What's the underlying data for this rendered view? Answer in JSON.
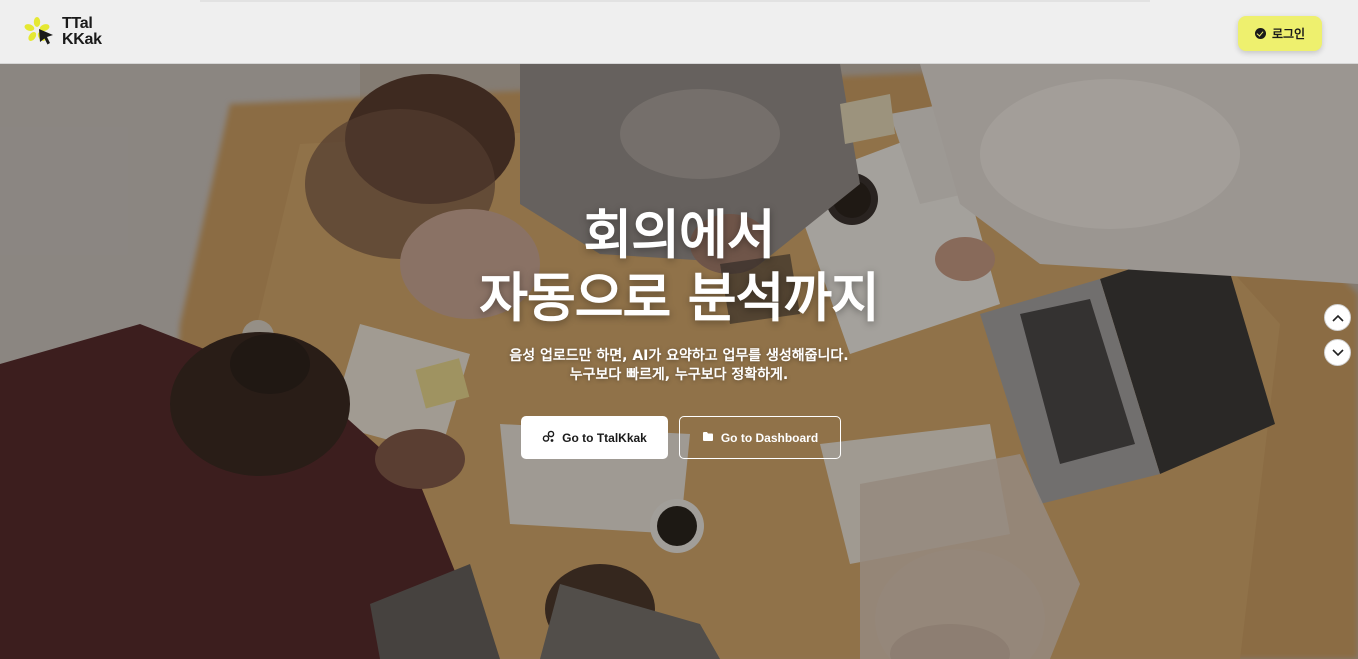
{
  "header": {
    "logo_line1": "TTal",
    "logo_line2": "KKak",
    "login_label": "로그인"
  },
  "hero": {
    "title_line1": "회의에서",
    "title_line2": "자동으로 분석까지",
    "subtitle_line1": "음성 업로드만 하면, AI가 요약하고 업무를 생성해줍니다.",
    "subtitle_line2": "누구보다 빠르게, 누구보다 정확하게.",
    "primary_cta": "Go to TtalKkak",
    "secondary_cta": "Go to Dashboard"
  },
  "icons": {
    "logo": "asterisk-cursor-logo-icon",
    "login": "check-circle-icon",
    "primary_cta": "link-icon",
    "secondary_cta": "folder-icon",
    "scroll_up": "chevron-up-icon",
    "scroll_down": "chevron-down-icon"
  },
  "colors": {
    "accent": "#eef06e",
    "logo_accent": "#e5e832",
    "header_bg": "#efefef",
    "text_dark": "#1a1a1a"
  }
}
